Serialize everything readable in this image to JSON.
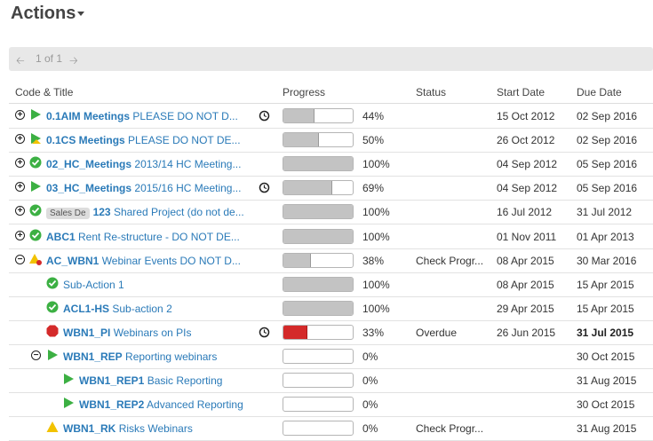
{
  "header": {
    "title": "Actions"
  },
  "pager": {
    "page_label": "1 of 1"
  },
  "columns": {
    "code_title": "Code & Title",
    "progress": "Progress",
    "status": "Status",
    "start": "Start Date",
    "due": "Due Date"
  },
  "rows": [
    {
      "code": "0.1AIM Meetings",
      "title": "PLEASE DO NOT D...",
      "progress": "44%",
      "progress_fraction": 0.44,
      "status": "",
      "start": "15 Oct 2012",
      "due": "02 Sep 2016"
    },
    {
      "code": "0.1CS Meetings",
      "title": "PLEASE DO NOT DE...",
      "progress": "50%",
      "progress_fraction": 0.5,
      "status": "",
      "start": "26 Oct 2012",
      "due": "02 Sep 2016"
    },
    {
      "code": "02_HC_Meetings",
      "title": "2013/14 HC Meeting...",
      "progress": "100%",
      "progress_fraction": 1.0,
      "status": "",
      "start": "04 Sep 2012",
      "due": "05 Sep 2016"
    },
    {
      "code": "03_HC_Meetings",
      "title": "2015/16 HC Meeting...",
      "progress": "69%",
      "progress_fraction": 0.69,
      "status": "",
      "start": "04 Sep 2012",
      "due": "05 Sep 2016"
    },
    {
      "badge": "Sales De",
      "code": "123",
      "title": "Shared Project (do not de...",
      "progress": "100%",
      "progress_fraction": 1.0,
      "status": "",
      "start": "16 Jul 2012",
      "due": "31 Jul 2012"
    },
    {
      "code": "ABC1",
      "title": "Rent Re-structure - DO NOT DE...",
      "progress": "100%",
      "progress_fraction": 1.0,
      "status": "",
      "start": "01 Nov 2011",
      "due": "01 Apr 2013"
    },
    {
      "code": "AC_WBN1",
      "title": "Webinar Events DO NOT D...",
      "progress": "38%",
      "progress_fraction": 0.38,
      "status": "Check Progr...",
      "start": "08 Apr 2015",
      "due": "30 Mar 2016"
    },
    {
      "code": "",
      "title": "Sub-Action 1",
      "progress": "100%",
      "progress_fraction": 1.0,
      "status": "",
      "start": "08 Apr 2015",
      "due": "15 Apr 2015"
    },
    {
      "code": "ACL1-HS",
      "title": "Sub-action 2",
      "progress": "100%",
      "progress_fraction": 1.0,
      "status": "",
      "start": "29 Apr 2015",
      "due": "15 Apr 2015"
    },
    {
      "code": "WBN1_PI",
      "title": "Webinars on PIs",
      "progress": "33%",
      "progress_fraction": 0.33,
      "status": "Overdue",
      "start": "26 Jun 2015",
      "due": "31 Jul 2015"
    },
    {
      "code": "WBN1_REP",
      "title": "Reporting webinars",
      "progress": "0%",
      "progress_fraction": 0,
      "status": "",
      "start": "",
      "due": "30 Oct 2015"
    },
    {
      "code": "WBN1_REP1",
      "title": "Basic Reporting",
      "progress": "0%",
      "progress_fraction": 0,
      "status": "",
      "start": "",
      "due": "31 Aug 2015"
    },
    {
      "code": "WBN1_REP2",
      "title": "Advanced Reporting",
      "progress": "0%",
      "progress_fraction": 0,
      "status": "",
      "start": "",
      "due": "30 Oct 2015"
    },
    {
      "code": "WBN1_RK",
      "title": "Risks Webinars",
      "progress": "0%",
      "progress_fraction": 0,
      "status": "Check Progr...",
      "start": "",
      "due": "31 Aug 2015"
    }
  ],
  "colors": {
    "link": "#2a7ab8",
    "green": "#3cb043",
    "red": "#d42a2a",
    "yellow": "#f2c200"
  }
}
